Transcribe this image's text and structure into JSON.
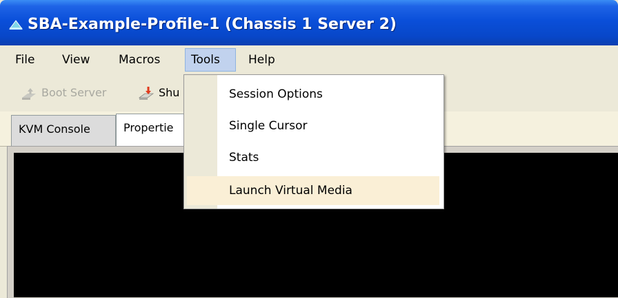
{
  "window": {
    "title": "SBA-Example-Profile-1 (Chassis 1 Server 2)",
    "icon": "app-icon"
  },
  "menubar": {
    "items": [
      {
        "label": "File"
      },
      {
        "label": "View"
      },
      {
        "label": "Macros"
      },
      {
        "label": "Tools",
        "open": true
      },
      {
        "label": "Help"
      }
    ]
  },
  "toolbar": {
    "boot_server": {
      "label": "Boot Server",
      "icon": "boot-server-icon",
      "enabled": false
    },
    "shutdown": {
      "label": "Shu",
      "icon": "shutdown-icon"
    }
  },
  "tabs": [
    {
      "label": "KVM Console",
      "active": false
    },
    {
      "label": "Propertie",
      "active": true
    }
  ],
  "tools_menu": {
    "items": [
      {
        "label": "Session Options"
      },
      {
        "label": "Single Cursor"
      },
      {
        "label": "Stats"
      },
      {
        "label": "Launch Virtual Media",
        "highlighted": true
      }
    ]
  },
  "colors": {
    "titlebar": "#0a4fd9",
    "menu_open": "#c1d2ee",
    "menu_highlight": "#faefd6",
    "console": "#000000"
  }
}
